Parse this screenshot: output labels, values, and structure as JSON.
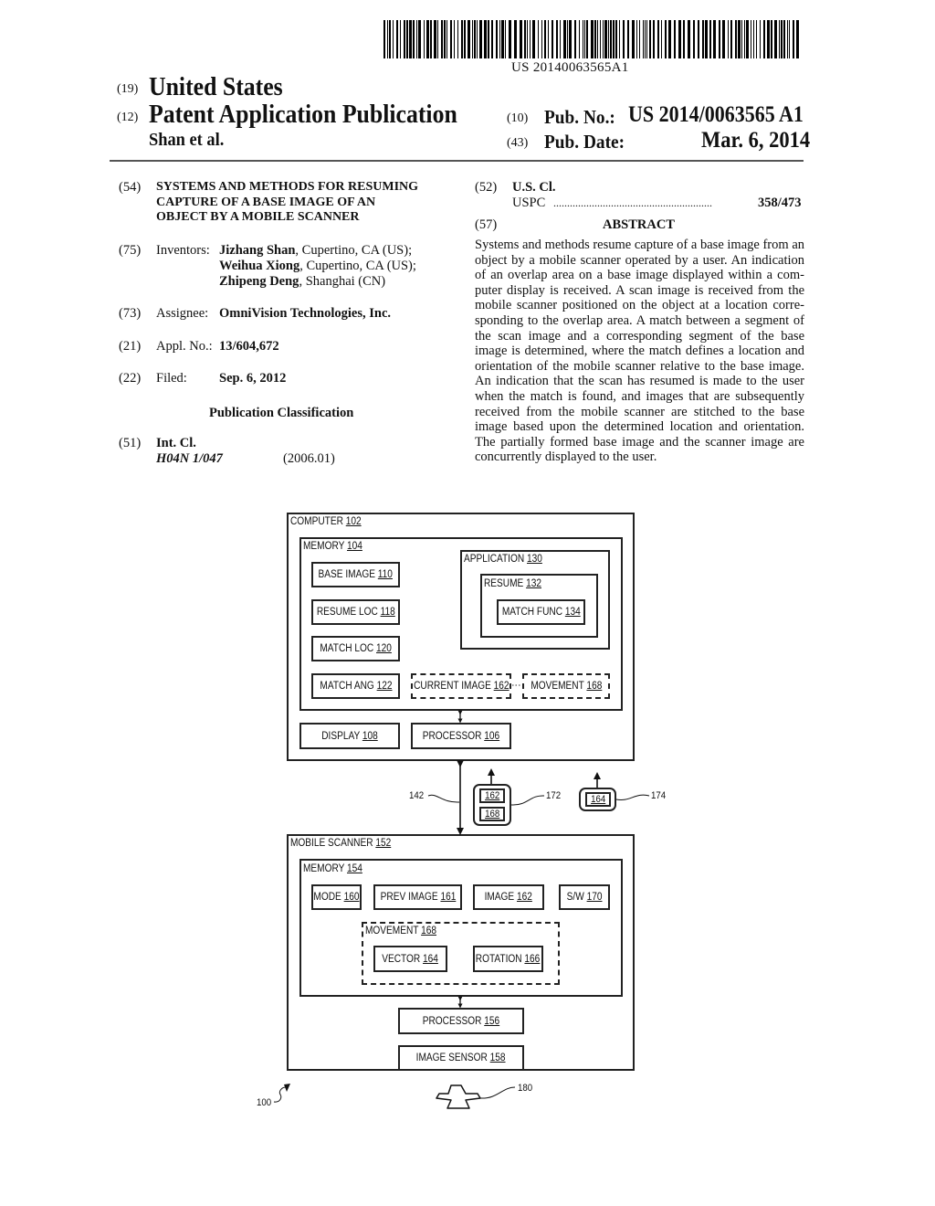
{
  "header": {
    "publication_number_barcode_text": "US 20140063565A1",
    "country_code": "(19)",
    "country": "United States",
    "type_code": "(12)",
    "type": "Patent Application Publication",
    "authors": "Shan et al.",
    "pub_no_code": "(10)",
    "pub_no_label": "Pub. No.:",
    "pub_no_value": "US 2014/0063565 A1",
    "pub_date_code": "(43)",
    "pub_date_label": "Pub. Date:",
    "pub_date_value": "Mar. 6, 2014"
  },
  "biblio": {
    "title_code": "(54)",
    "title_lines": [
      "SYSTEMS AND METHODS FOR RESUMING",
      "CAPTURE OF A BASE IMAGE OF AN",
      "OBJECT BY A MOBILE SCANNER"
    ],
    "inventors_code": "(75)",
    "inventors_label": "Inventors:",
    "inventors": [
      {
        "name": "Jizhang Shan",
        "location": ", Cupertino, CA (US);"
      },
      {
        "name": "Weihua Xiong",
        "location": ", Cupertino, CA (US);"
      },
      {
        "name": "Zhipeng Deng",
        "location": ", Shanghai (CN)"
      }
    ],
    "assignee_code": "(73)",
    "assignee_label": "Assignee:",
    "assignee": "OmniVision Technologies, Inc.",
    "appl_code": "(21)",
    "appl_label": "Appl. No.:",
    "appl_value": "13/604,672",
    "filed_code": "(22)",
    "filed_label": "Filed:",
    "filed_value": "Sep. 6, 2012",
    "pub_class_heading": "Publication Classification",
    "int_cl_code": "(51)",
    "int_cl_label": "Int. Cl.",
    "int_cl_value": "H04N 1/047",
    "int_cl_version": "(2006.01)",
    "us_cl_code": "(52)",
    "us_cl_label": "U.S. Cl.",
    "uspc_label": "USPC",
    "uspc_dots": "..........................................................",
    "uspc_value": "358/473"
  },
  "abstract": {
    "code": "(57)",
    "heading": "ABSTRACT",
    "text": "Systems and methods resume capture of a base image from an object by a mobile scanner operated by a user. An indication of an overlap area on a base image displayed within a com­puter display is received. A scan image is received from the mobile scanner positioned on the object at a location corre­sponding to the overlap area. A match between a segment of the scan image and a corresponding segment of the base image is determined, where the match defines a location and orientation of the mobile scanner relative to the base image. An indication that the scan has resumed is made to the user when the match is found, and images that are subsequently received from the mobile scanner are stitched to the base image based upon the determined location and orientation. The partially formed base image and the scanner image are concurrently displayed to the user."
  },
  "diagram": {
    "computer": {
      "label": "COMPUTER",
      "ref": "102"
    },
    "memory_104": {
      "label": "MEMORY",
      "ref": "104"
    },
    "base_image": {
      "label": "BASE IMAGE",
      "ref": "110"
    },
    "resume_loc": {
      "label": "RESUME LOC",
      "ref": "118"
    },
    "match_loc": {
      "label": "MATCH LOC",
      "ref": "120"
    },
    "match_ang": {
      "label": "MATCH ANG",
      "ref": "122"
    },
    "current_image": {
      "label": "CURRENT IMAGE",
      "ref": "162"
    },
    "movement_pc": {
      "label": "MOVEMENT",
      "ref": "168"
    },
    "application": {
      "label": "APPLICATION",
      "ref": "130"
    },
    "resume": {
      "label": "RESUME",
      "ref": "132"
    },
    "match_func": {
      "label": "MATCH FUNC",
      "ref": "134"
    },
    "display": {
      "label": "DISPLAY",
      "ref": "108"
    },
    "processor_106": {
      "label": "PROCESSOR",
      "ref": "106"
    },
    "bus_ref": "142",
    "packet_172": {
      "ref": "172",
      "items": [
        "162",
        "168"
      ]
    },
    "packet_174": {
      "ref": "174",
      "items": [
        "164"
      ]
    },
    "mobile_scanner": {
      "label": "MOBILE SCANNER",
      "ref": "152"
    },
    "memory_154": {
      "label": "MEMORY",
      "ref": "154"
    },
    "mode": {
      "label": "MODE",
      "ref": "160"
    },
    "prev_image": {
      "label": "PREV IMAGE",
      "ref": "161"
    },
    "image": {
      "label": "IMAGE",
      "ref": "162"
    },
    "sw": {
      "label": "S/W",
      "ref": "170"
    },
    "movement_ms": {
      "label": "MOVEMENT",
      "ref": "168"
    },
    "vector": {
      "label": "VECTOR",
      "ref": "164"
    },
    "rotation": {
      "label": "ROTATION",
      "ref": "166"
    },
    "processor_156": {
      "label": "PROCESSOR",
      "ref": "156"
    },
    "image_sensor": {
      "label": "IMAGE SENSOR",
      "ref": "158"
    },
    "object_ref": "180",
    "figure_ref": "100"
  }
}
